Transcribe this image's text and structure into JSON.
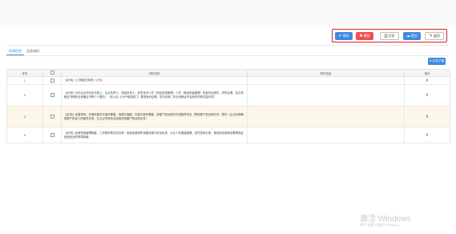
{
  "toolbar": {
    "buttons": [
      {
        "label": "保存",
        "icon": "check-icon",
        "glyph": "✔"
      },
      {
        "label": "删除",
        "icon": "close-icon",
        "glyph": "✖"
      },
      {
        "label": "打印",
        "icon": "printer-icon",
        "glyph": "⎙"
      },
      {
        "label": "提交",
        "icon": "cloud-upload-icon",
        "glyph": "☁"
      },
      {
        "label": "返回",
        "icon": "back-arrow-icon",
        "glyph": "↰"
      }
    ],
    "highlight_color": "#e02020"
  },
  "tabs": [
    {
      "label": "申请信息",
      "active": true
    },
    {
      "label": "业务材料",
      "active": false
    }
  ],
  "download_button": {
    "label": "打包下载",
    "glyph": "⬇"
  },
  "table": {
    "headers": [
      "序号",
      "",
      "材料名称",
      "附件信息",
      "操作"
    ],
    "rows": [
      {
        "index": "1",
        "content": "【必传】《工商营业执照》",
        "suffix": "(必传)",
        "attachment": "",
        "action_icon": "upload-icon",
        "action_glyph": "⬆",
        "highlight": false
      },
      {
        "index": "2",
        "content": "【必传】对办企业的法定代表人、企业负责人、质量负责人、药学技术人员（药品质量管理）人员（食品质量管理）的身份证原件、学历证明、执业资格证书和职业资格证书等个人履历。（在以后《GSP相关部门）要求身份证明、学历证明、执业资格证书及相关材料的复印件）",
        "suffix": "",
        "attachment": "",
        "action_icon": "upload-icon",
        "action_glyph": "⬆",
        "highlight": false
      },
      {
        "index": "3",
        "content": "【必传】经营场所、仓储设施的平面布置图、地理平面图、内部平面布置图、房屋产权证明文件或租赁协议（附房屋产权证明文件）原件（企业应明确房屋产权证人的租赁合同，业主必须有依法经营的房屋产权证明文件）",
        "suffix": "",
        "attachment": "",
        "action_icon": "upload-icon",
        "action_glyph": "⬆",
        "highlight": true
      },
      {
        "index": "4",
        "content": "【必传】经营质量管理制度、工作程序等文件目录；食品经营场所设备设施与安全检查、从业人员健康管理、进货查验记录、食品安全事故处置等保证食品安全的规章制度。",
        "suffix": "",
        "attachment": "",
        "action_icon": "upload-icon",
        "action_glyph": "⬆",
        "highlight": false
      }
    ]
  },
  "watermark": {
    "line1": "激活 Windows",
    "line2": "转到\"设置\"以激活 Windows。"
  }
}
